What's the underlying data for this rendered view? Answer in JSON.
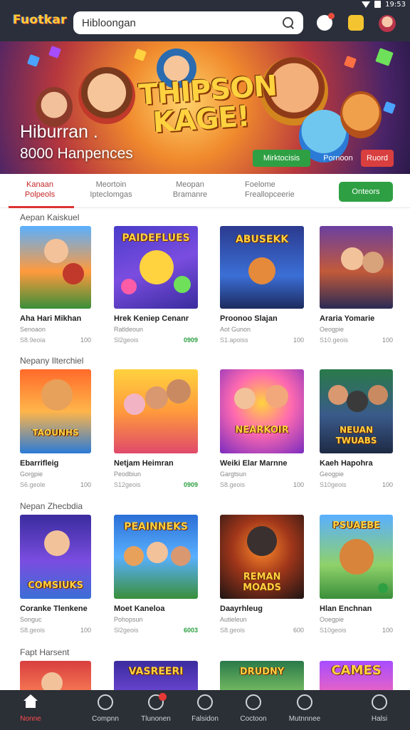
{
  "header": {
    "logo": "Fuotkar",
    "search_value": "Hibloongan",
    "status_time": "19:53"
  },
  "banner": {
    "art_title_line1": "THIPSON",
    "art_title_line2": "KAGE!",
    "heading": "Hiburran .",
    "count": "8000 Hanpences",
    "buttons": [
      "Mirktocisis",
      "Pornoon",
      "Ruord"
    ]
  },
  "tabs": {
    "items": [
      {
        "line1": "Kanaan",
        "line2": "Polpeols"
      },
      {
        "line1": "Meortoin",
        "line2": "Ipteclomgas"
      },
      {
        "line1": "Meopan",
        "line2": "Bramanre"
      },
      {
        "line1": "Foelome",
        "line2": "Freallopceerie"
      }
    ],
    "action_button": "Onteors"
  },
  "sections": [
    {
      "title": "Aepan Kaiskuel",
      "cards": [
        {
          "art": "",
          "title": "Aha Hari Mikhan",
          "sub": "Senoaon",
          "meta": "S8.9eoia",
          "price": "100",
          "green": false
        },
        {
          "art": "PAIDEFLUES",
          "title": "Hrek Keniep Cenanr",
          "sub": "Ratldeoun",
          "meta": "Sl2geois",
          "price": "0909",
          "green": true
        },
        {
          "art": "ABUSEKK",
          "title": "Proonoo Slajan",
          "sub": "Aot Gunon",
          "meta": "S1.apoiss",
          "price": "100",
          "green": false
        },
        {
          "art": "",
          "title": "Araria Yomarie",
          "sub": "Oeogpie",
          "meta": "S10.geois",
          "price": "100",
          "green": false
        }
      ]
    },
    {
      "title": "Nepany Ilterchiel",
      "cards": [
        {
          "art": "TAOUNHS",
          "title": "Ebarrifleig",
          "sub": "Gorgpie",
          "meta": "S6.geole",
          "price": "100",
          "green": false
        },
        {
          "art": "",
          "title": "Netjam Heimran",
          "sub": "Peodbiun",
          "meta": "S12geois",
          "price": "0909",
          "green": true
        },
        {
          "art": "NEARKOIR",
          "title": "Weiki Elar Marnne",
          "sub": "Gargtsun",
          "meta": "S8.geois",
          "price": "100",
          "green": false
        },
        {
          "art": "NEUAN TWUABS",
          "title": "Kaeh Hapohra",
          "sub": "Geogpie",
          "meta": "S10geois",
          "price": "100",
          "green": false
        }
      ]
    },
    {
      "title": "Nepan Zhecbdia",
      "cards": [
        {
          "art": "COMSIUKS",
          "title": "Coranke Tlenkene",
          "sub": "Songuc",
          "meta": "S8.geois",
          "price": "100",
          "green": false
        },
        {
          "art": "PEAINNEKS",
          "title": "Moet Kaneloa",
          "sub": "Pohopsun",
          "meta": "Sl2geois",
          "price": "6003",
          "green": true
        },
        {
          "art": "REMAN MOADS",
          "title": "Daayrhleug",
          "sub": "Autieleun",
          "meta": "S8.geois",
          "price": "600",
          "green": false
        },
        {
          "art": "PSUAEBE",
          "title": "Hlan Enchnan",
          "sub": "Ooegpie",
          "meta": "S10geois",
          "price": "100",
          "green": false
        }
      ]
    },
    {
      "title": "Fapt Harsent",
      "cards": [
        {
          "art": "",
          "title": "",
          "sub": "",
          "meta": "",
          "price": "",
          "green": false
        },
        {
          "art": "VASREERI",
          "title": "",
          "sub": "",
          "meta": "",
          "price": "",
          "green": false
        },
        {
          "art": "DRUDNY",
          "title": "",
          "sub": "",
          "meta": "",
          "price": "",
          "green": false
        },
        {
          "art": "CAMES",
          "title": "",
          "sub": "",
          "meta": "",
          "price": "",
          "green": false
        }
      ]
    }
  ],
  "bottom_nav": [
    {
      "label": "Nonne",
      "icon": "home-icon",
      "active": true
    },
    {
      "label": "Compnn",
      "icon": "clock-icon",
      "active": false
    },
    {
      "label": "Tlunonen",
      "icon": "alert-icon",
      "active": false
    },
    {
      "label": "Falsidon",
      "icon": "compass-icon",
      "active": false
    },
    {
      "label": "Coctoon",
      "icon": "info-icon",
      "active": false
    },
    {
      "label": "Mutnnnee",
      "icon": "globe-icon",
      "active": false
    },
    {
      "label": "Halsi",
      "icon": "search-icon",
      "active": false
    }
  ],
  "colors": {
    "header_bg": "#2a2f3b",
    "accent_red": "#d33333",
    "accent_green": "#2ea043",
    "nav_bg": "#2b2f36"
  }
}
